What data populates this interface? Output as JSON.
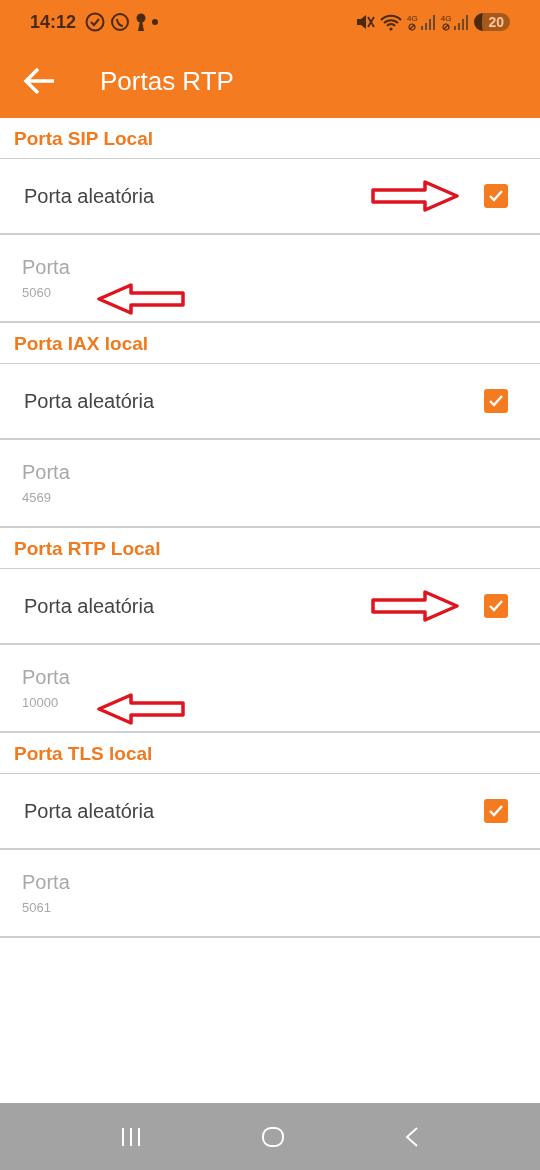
{
  "status_bar": {
    "time": "14:12",
    "network_labels": [
      "4G",
      "4G"
    ],
    "battery": "20"
  },
  "toolbar": {
    "title": "Portas RTP"
  },
  "sections": [
    {
      "title": "Porta SIP Local",
      "checkbox": {
        "label": "Porta aleatória",
        "checked": true,
        "annotated": true
      },
      "port": {
        "label": "Porta",
        "value": "5060",
        "disabled": true,
        "annotated": true
      }
    },
    {
      "title": "Porta IAX local",
      "checkbox": {
        "label": "Porta aleatória",
        "checked": true,
        "annotated": false
      },
      "port": {
        "label": "Porta",
        "value": "4569",
        "disabled": true,
        "annotated": false
      }
    },
    {
      "title": "Porta RTP Local",
      "checkbox": {
        "label": "Porta aleatória",
        "checked": true,
        "annotated": true
      },
      "port": {
        "label": "Porta",
        "value": "10000",
        "disabled": true,
        "annotated": true
      }
    },
    {
      "title": "Porta TLS local",
      "checkbox": {
        "label": "Porta aleatória",
        "checked": true,
        "annotated": false
      },
      "port": {
        "label": "Porta",
        "value": "5061",
        "disabled": true,
        "annotated": false
      }
    }
  ]
}
